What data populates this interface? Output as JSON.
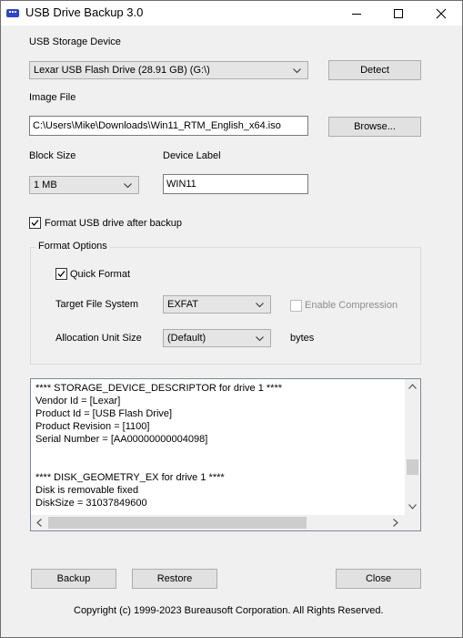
{
  "window": {
    "title": "USB Drive Backup 3.0",
    "minimize_icon": "minimize-icon",
    "maximize_icon": "maximize-icon",
    "close_icon": "close-icon"
  },
  "usb_device": {
    "label": "USB Storage Device",
    "selected": "Lexar USB Flash Drive (28.91 GB) (G:\\)",
    "detect_button": "Detect"
  },
  "image_file": {
    "label": "Image File",
    "value": "C:\\Users\\Mike\\Downloads\\Win11_RTM_English_x64.iso",
    "browse_button": "Browse..."
  },
  "block_size": {
    "label": "Block Size",
    "selected": "1 MB"
  },
  "device_label": {
    "label": "Device Label",
    "value": "WIN11"
  },
  "format_after_backup": {
    "label": "Format USB drive after backup",
    "checked": true
  },
  "format_options": {
    "group_label": "Format Options",
    "quick_format": {
      "label": "Quick Format",
      "checked": true
    },
    "target_fs": {
      "label": "Target File System",
      "selected": "EXFAT"
    },
    "enable_compression": {
      "label": "Enable Compression",
      "checked": false,
      "enabled": false
    },
    "alloc_unit": {
      "label": "Allocation Unit Size",
      "selected": "(Default)",
      "unit": "bytes"
    }
  },
  "log": {
    "lines": [
      "**** STORAGE_DEVICE_DESCRIPTOR for drive 1 ****",
      "Vendor Id = [Lexar]",
      "Product Id = [USB Flash Drive]",
      "Product Revision = [1100]",
      "Serial Number = [AA00000000004098]",
      "",
      "",
      "**** DISK_GEOMETRY_EX for drive 1 ****",
      "Disk is removable fixed",
      "DiskSize = 31037849600"
    ]
  },
  "buttons": {
    "backup": "Backup",
    "restore": "Restore",
    "close": "Close"
  },
  "footer": {
    "copyright": "Copyright (c) 1999-2023 Bureausoft Corporation. All Rights Reserved."
  },
  "colors": {
    "titlebar": "#ffffff",
    "window_bg": "#f0f0f0",
    "app_icon": "#2b46c8"
  }
}
